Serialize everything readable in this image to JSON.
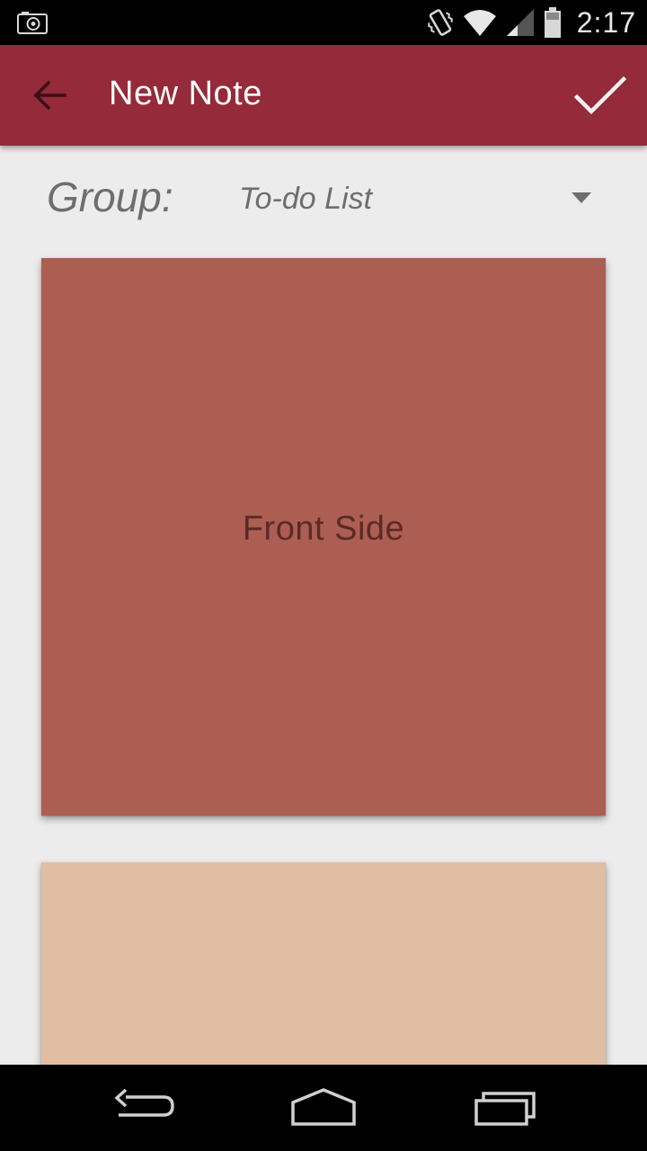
{
  "status_bar": {
    "time": "2:17",
    "icons": [
      "camera-icon",
      "vibrate-icon",
      "wifi-icon",
      "signal-icon",
      "battery-icon"
    ]
  },
  "app_bar": {
    "title": "New Note",
    "back_icon": "arrow-back-icon",
    "done_icon": "check-icon",
    "color": "#952a3a"
  },
  "group": {
    "label": "Group:",
    "selected": "To-do List"
  },
  "cards": {
    "front": {
      "label": "Front Side",
      "color": "#ad5e53"
    },
    "back": {
      "color": "#e0bea3"
    }
  },
  "nav_bar": {
    "icons": [
      "nav-back-icon",
      "nav-home-icon",
      "nav-recents-icon"
    ]
  }
}
